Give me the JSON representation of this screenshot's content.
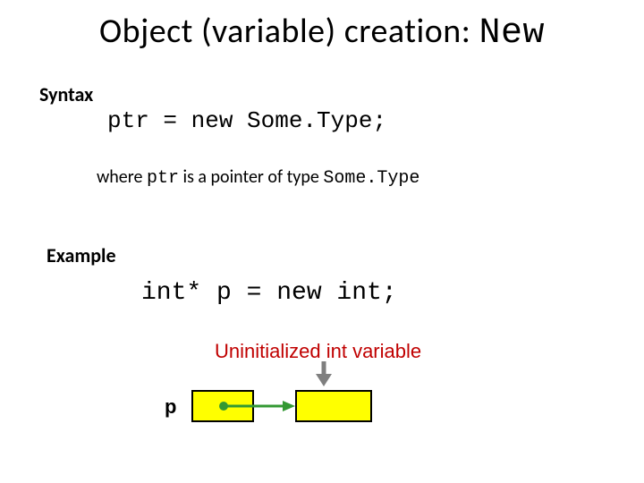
{
  "title": {
    "prefix": "Object (variable) creation:  ",
    "keyword": "New"
  },
  "syntax": {
    "label": "Syntax",
    "code": "ptr = new Some.Type;",
    "where_prefix": "where ",
    "where_ptr": "ptr",
    "where_mid": " is a pointer of type ",
    "where_type": "Some.Type"
  },
  "example": {
    "label": "Example",
    "code": "int* p = new int;"
  },
  "diagram": {
    "uninit_label": "Uninitialized int variable",
    "p_label": "p"
  }
}
